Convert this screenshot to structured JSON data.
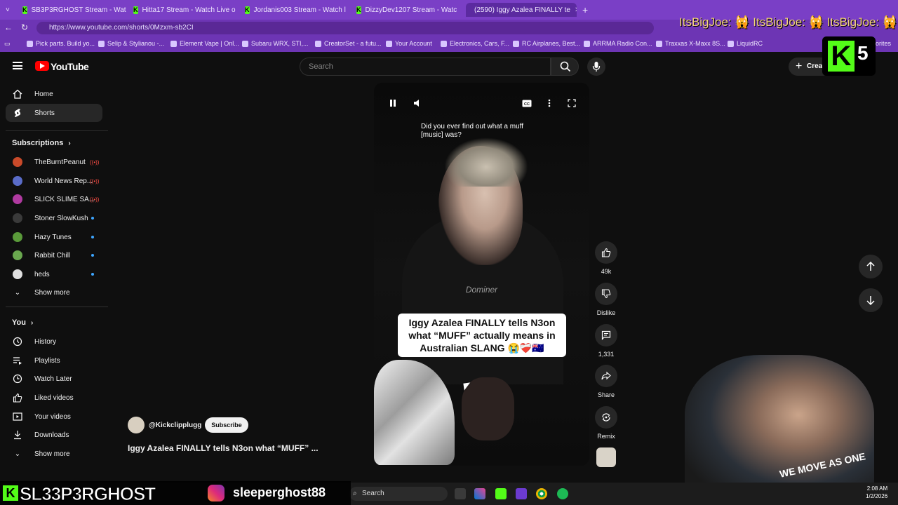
{
  "browser": {
    "tabs": [
      {
        "title": "SB3P3RGHOST Stream - Watc"
      },
      {
        "title": "Hitta17 Stream - Watch Live o"
      },
      {
        "title": "Jordanis003 Stream - Watch l"
      },
      {
        "title": "DizzyDev1207 Stream - Watc"
      },
      {
        "title": "(2590) Iggy Azalea FINALLY te"
      }
    ],
    "new_tab_label": "+",
    "url": "https://www.youtube.com/shorts/0Mzxm-sb2CI",
    "bookmarks": [
      "Pick parts. Build yo...",
      "Selip & Stylianou -...",
      "Element Vape | Onl...",
      "Subaru WRX, STI,...",
      "CreatorSet - a futu...",
      "Your Account",
      "Electronics, Cars, F...",
      "RC Airplanes, Best...",
      "ARRMA Radio Con...",
      "Traxxas X-Maxx 8S...",
      "LiquidRC"
    ],
    "bookmarks_overflow": "orites"
  },
  "youtube": {
    "logo_text": "YouTube",
    "search_placeholder": "Search",
    "create_label": "Creat",
    "sidebar": {
      "main": [
        {
          "label": "Home",
          "icon": "home-icon"
        },
        {
          "label": "Shorts",
          "icon": "shorts-icon",
          "active": true
        }
      ],
      "subscriptions_header": "Subscriptions",
      "subscriptions": [
        {
          "label": "TheBurntPeanut",
          "status": "live",
          "color": "#c94a2a"
        },
        {
          "label": "World News Rep...",
          "status": "live",
          "color": "#5a6cc8"
        },
        {
          "label": "SLICK SLIME SA...",
          "status": "live",
          "color": "#b03aa0"
        },
        {
          "label": "Stoner SlowKush",
          "status": "new",
          "color": "#3a3a3a"
        },
        {
          "label": "Hazy Tunes",
          "status": "new",
          "color": "#5a9a3a"
        },
        {
          "label": "Rabbit Chill",
          "status": "new",
          "color": "#6aa84f"
        },
        {
          "label": "heds",
          "status": "new",
          "color": "#e0e0e0"
        }
      ],
      "show_more_1": "Show more",
      "you_header": "You",
      "you": [
        {
          "label": "History",
          "icon": "history-icon"
        },
        {
          "label": "Playlists",
          "icon": "playlists-icon"
        },
        {
          "label": "Watch Later",
          "icon": "watch-later-icon"
        },
        {
          "label": "Liked videos",
          "icon": "thumbs-up-icon"
        },
        {
          "label": "Your videos",
          "icon": "your-videos-icon"
        },
        {
          "label": "Downloads",
          "icon": "download-icon"
        }
      ],
      "show_more_2": "Show more"
    },
    "short": {
      "caption": "Did you ever find out what a muff [music] was?",
      "watermark": "Dominer",
      "overlay_title": "Iggy Azalea FINALLY tells N3on what “MUFF” actually means in Australian SLANG 😭❤️‍🩹🇦🇺",
      "channel": "@Kickclipplugg",
      "subscribe_label": "Subscribe",
      "title": "Iggy Azalea FINALLY tells N3on what “MUFF” ..."
    },
    "actions": {
      "likes": "49k",
      "dislike_label": "Dislike",
      "comments": "1,331",
      "share_label": "Share",
      "remix_label": "Remix"
    }
  },
  "stream_overlay": {
    "chat_text": "ItsBigJoe: 🙀 ItsBigJoe: 🙀 ItsBigJoe: 🙀",
    "kick_letter": "K",
    "kick_count": "5",
    "streamer_name": "SL33P3RGHOST",
    "instagram_handle": "sleeperghost88",
    "webcam_shirt_text": "WE MOVE AS ONE"
  },
  "taskbar": {
    "search_label": "Search",
    "time": "2:08 AM",
    "date": "1/2/2026"
  }
}
